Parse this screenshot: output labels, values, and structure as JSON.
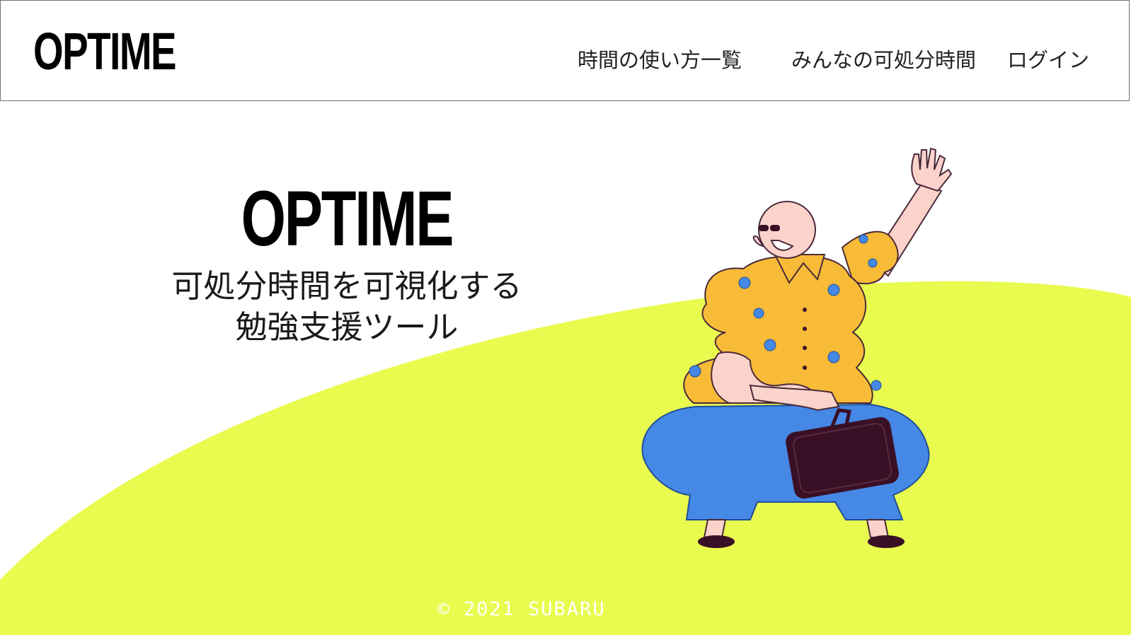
{
  "header": {
    "logo": "OPTIME",
    "nav": [
      {
        "label": "時間の使い方一覧"
      },
      {
        "label": "みんなの可処分時間"
      },
      {
        "label": "ログイン"
      }
    ]
  },
  "hero": {
    "title": "OPTIME",
    "tagline_line1": "可処分時間を可視化する",
    "tagline_line2": "勉強支援ツール"
  },
  "footer": {
    "copyright": "© 2021 SUBARU"
  },
  "colors": {
    "hill": "#e9fb4f",
    "shirt": "#f7bb37",
    "pants": "#4588e6",
    "skin": "#fcd3cb",
    "briefcase": "#3a1026",
    "text": "#000000"
  }
}
